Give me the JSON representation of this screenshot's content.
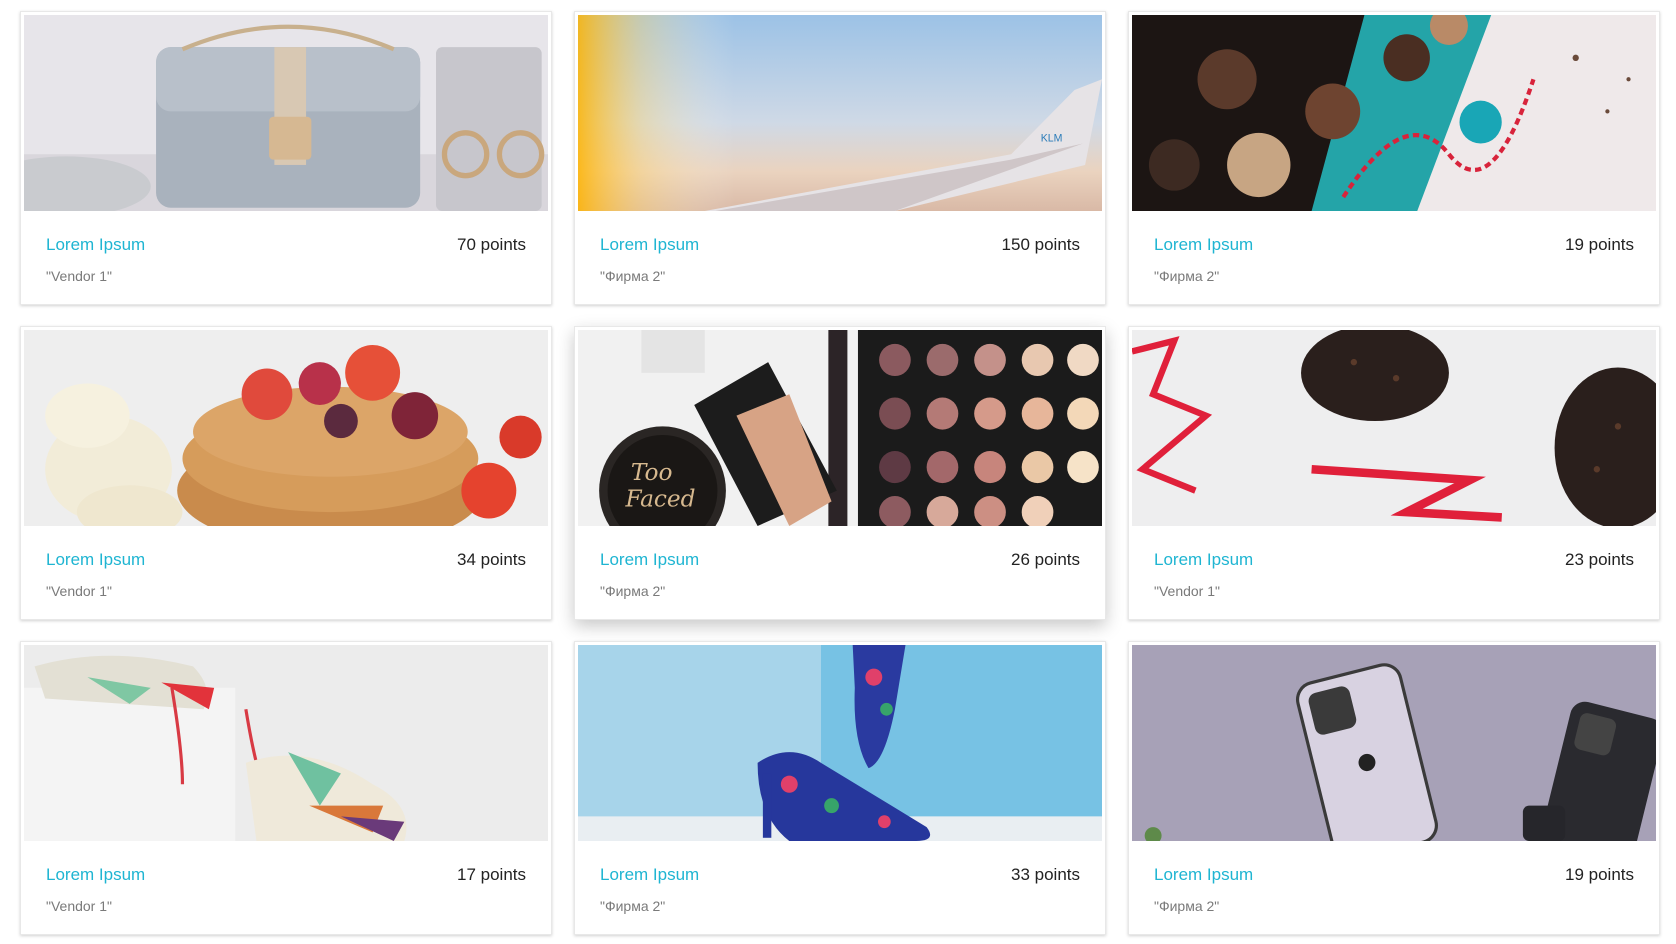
{
  "products": [
    {
      "title": "Lorem Ipsum",
      "points": "70 points",
      "vendor": "\"Vendor 1\"",
      "image": "handbag-earrings-photo"
    },
    {
      "title": "Lorem Ipsum",
      "points": "150 points",
      "vendor": "\"Фирма 2\"",
      "image": "airplane-wing-photo"
    },
    {
      "title": "Lorem Ipsum",
      "points": "19 points",
      "vendor": "\"Фирма 2\"",
      "image": "chocolates-box-photo"
    },
    {
      "title": "Lorem Ipsum",
      "points": "34 points",
      "vendor": "\"Vendor 1\"",
      "image": "pancakes-berries-photo"
    },
    {
      "title": "Lorem Ipsum",
      "points": "26 points",
      "vendor": "\"Фирма 2\"",
      "image": "makeup-palette-photo"
    },
    {
      "title": "Lorem Ipsum",
      "points": "23 points",
      "vendor": "\"Vendor 1\"",
      "image": "chocolate-hearts-photo"
    },
    {
      "title": "Lorem Ipsum",
      "points": "17 points",
      "vendor": "\"Vendor 1\"",
      "image": "sneakers-photo"
    },
    {
      "title": "Lorem Ipsum",
      "points": "33 points",
      "vendor": "\"Фирма 2\"",
      "image": "high-heels-photo"
    },
    {
      "title": "Lorem Ipsum",
      "points": "19 points",
      "vendor": "\"Фирма 2\"",
      "image": "smartphones-photo"
    }
  ],
  "colors": {
    "accent": "#1fb5d2",
    "points_text": "#222222",
    "vendor_text": "#7a7a7a"
  }
}
